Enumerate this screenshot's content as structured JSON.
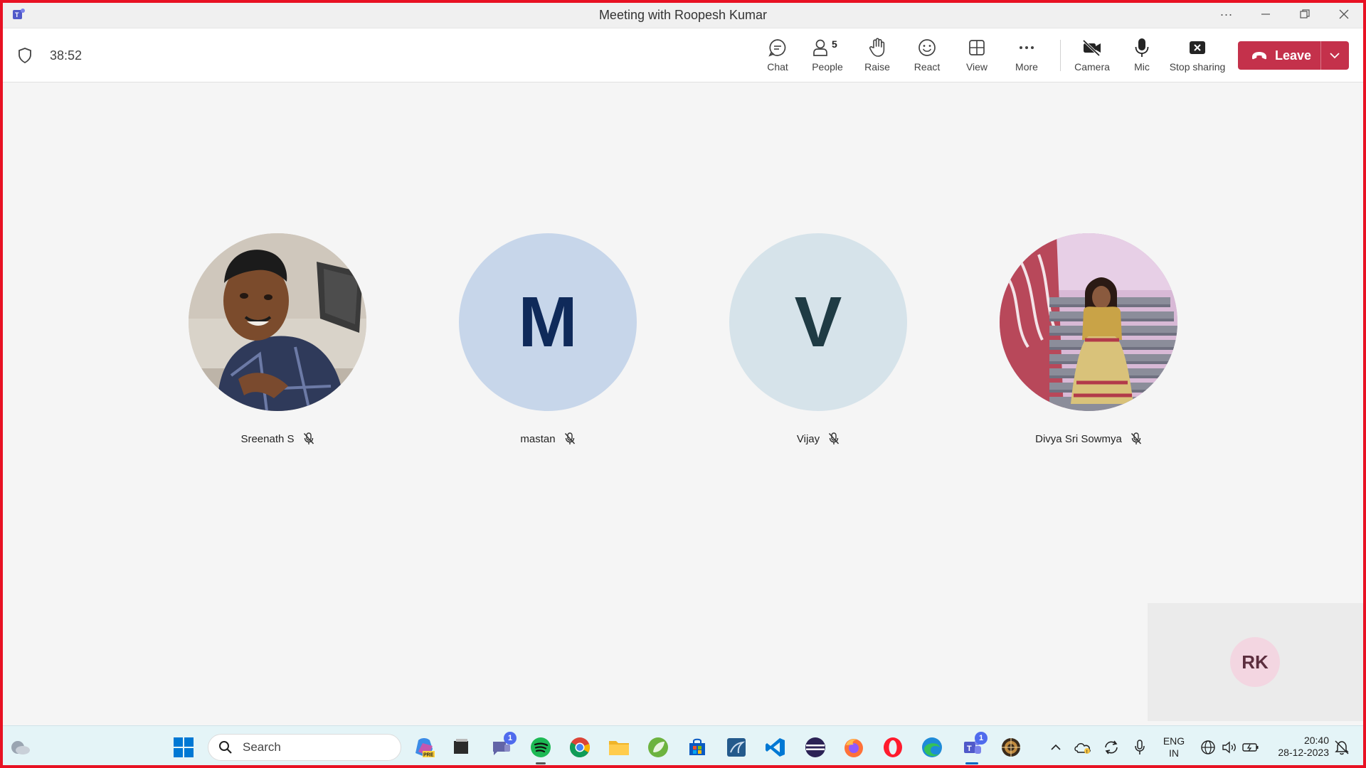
{
  "window": {
    "title": "Meeting with Roopesh Kumar"
  },
  "toolbar": {
    "timer": "38:52",
    "chat_label": "Chat",
    "people_label": "People",
    "people_count": "5",
    "raise_label": "Raise",
    "react_label": "React",
    "view_label": "View",
    "more_label": "More",
    "camera_label": "Camera",
    "mic_label": "Mic",
    "stop_sharing_label": "Stop sharing",
    "leave_label": "Leave"
  },
  "participants": [
    {
      "name": "Sreenath S",
      "initial": "",
      "muted": true
    },
    {
      "name": "mastan",
      "initial": "M",
      "muted": true
    },
    {
      "name": "Vijay",
      "initial": "V",
      "muted": true
    },
    {
      "name": "Divya Sri Sowmya",
      "initial": "",
      "muted": true
    }
  ],
  "self_view": {
    "initials": "RK"
  },
  "taskbar": {
    "search_label": "Search",
    "chat_badge": "1",
    "teams_badge": "1",
    "lang_line1": "ENG",
    "lang_line2": "IN",
    "time": "20:40",
    "date": "28-12-2023"
  },
  "colors": {
    "frame": "#e81123",
    "leave": "#c4314b",
    "avatar_m_bg": "#c7d6ea",
    "avatar_m_fg": "#0f2a5a",
    "avatar_v_bg": "#d6e3ea",
    "avatar_v_fg": "#1f3b44",
    "self_avatar_bg": "#f3d6e1",
    "taskbar_bg": "#e4f4f7"
  }
}
